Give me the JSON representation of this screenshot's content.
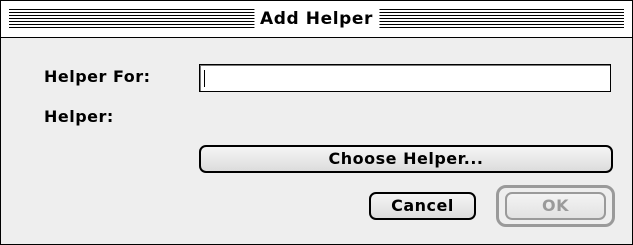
{
  "dialog": {
    "title": "Add Helper"
  },
  "form": {
    "helper_for_label": "Helper For:",
    "helper_for_value": "",
    "helper_label": "Helper:"
  },
  "buttons": {
    "choose_helper": "Choose Helper...",
    "cancel": "Cancel",
    "ok": "OK",
    "ok_disabled": true
  }
}
